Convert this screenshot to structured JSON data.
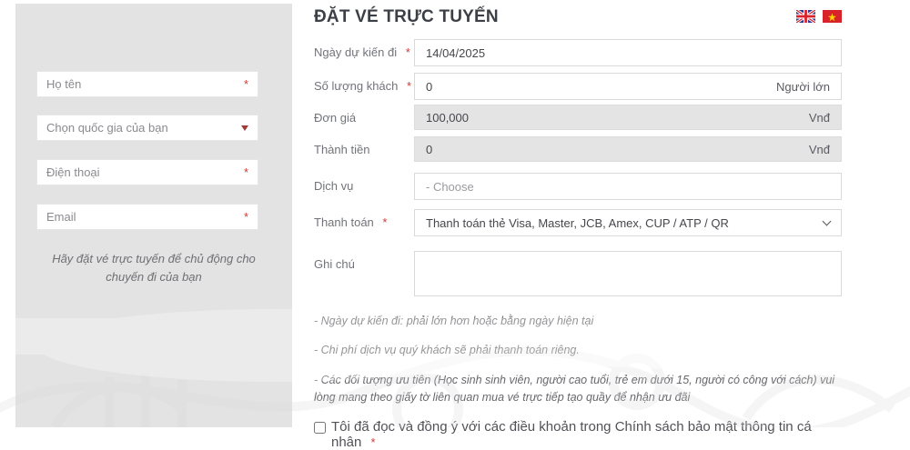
{
  "header": {
    "title": "ĐẶT VÉ TRỰC TUYẾN",
    "flags": [
      {
        "name": "uk-flag",
        "colors": {
          "field": "#2b3990",
          "cross": "#d8232a",
          "white": "#ffffff"
        }
      },
      {
        "name": "vietnam-flag",
        "colors": {
          "field": "#d8232a",
          "star": "#ffd400"
        },
        "star_glyph": "★"
      }
    ]
  },
  "ui": {
    "required_mark": "*",
    "colors": {
      "accent_red": "#cf3a37",
      "sidebar_bg": "#e3e3e3",
      "disabled_bg": "#e4e4e4"
    }
  },
  "sidebar": {
    "fields": [
      {
        "placeholder": "Họ tên",
        "required": "*"
      },
      {
        "placeholder": "Chọn quốc gia của bạn"
      },
      {
        "placeholder": "Điện thoại",
        "required": "*"
      },
      {
        "placeholder": "Email",
        "required": "*"
      }
    ],
    "note": "Hãy đặt vé trực tuyến để chủ động cho chuyến đi của bạn"
  },
  "form": {
    "date": {
      "label": "Ngày dự kiến đi",
      "required": "*",
      "value": "14/04/2025"
    },
    "quantity": {
      "label": "Số lượng khách",
      "required": "*",
      "value": "0",
      "suffix": "Người lớn"
    },
    "unit_price": {
      "label": "Đơn giá",
      "value": "100,000",
      "suffix": "Vnđ"
    },
    "total": {
      "label": "Thành tiền",
      "value": "0",
      "suffix": "Vnđ"
    },
    "service": {
      "label": "Dịch vụ",
      "placeholder": "- Choose"
    },
    "payment": {
      "label": "Thanh toán",
      "required": "*",
      "value": "Thanh toán thẻ Visa, Master, JCB, Amex, CUP / ATP / QR"
    },
    "note_field": {
      "label": "Ghi chú",
      "value": ""
    }
  },
  "notes": [
    "- Ngày dự kiến đi: phải lớn hơn hoặc bằng ngày hiện tại",
    "- Chi phí dịch vụ quý khách sẽ phải thanh toán riêng.",
    "- Các đối tượng ưu tiên (Học sinh sinh viên, người cao tuổi, trẻ em dưới 15, người có công với cách) vui lòng mang theo giấy tờ liên quan mua vé trực tiếp tạo quầy để nhận ưu đãi"
  ],
  "agreement": {
    "label": "Tôi đã đọc và đồng ý với các điều khoản trong Chính sách bảo mật thông tin cá nhân",
    "required": "*",
    "checked": false
  }
}
